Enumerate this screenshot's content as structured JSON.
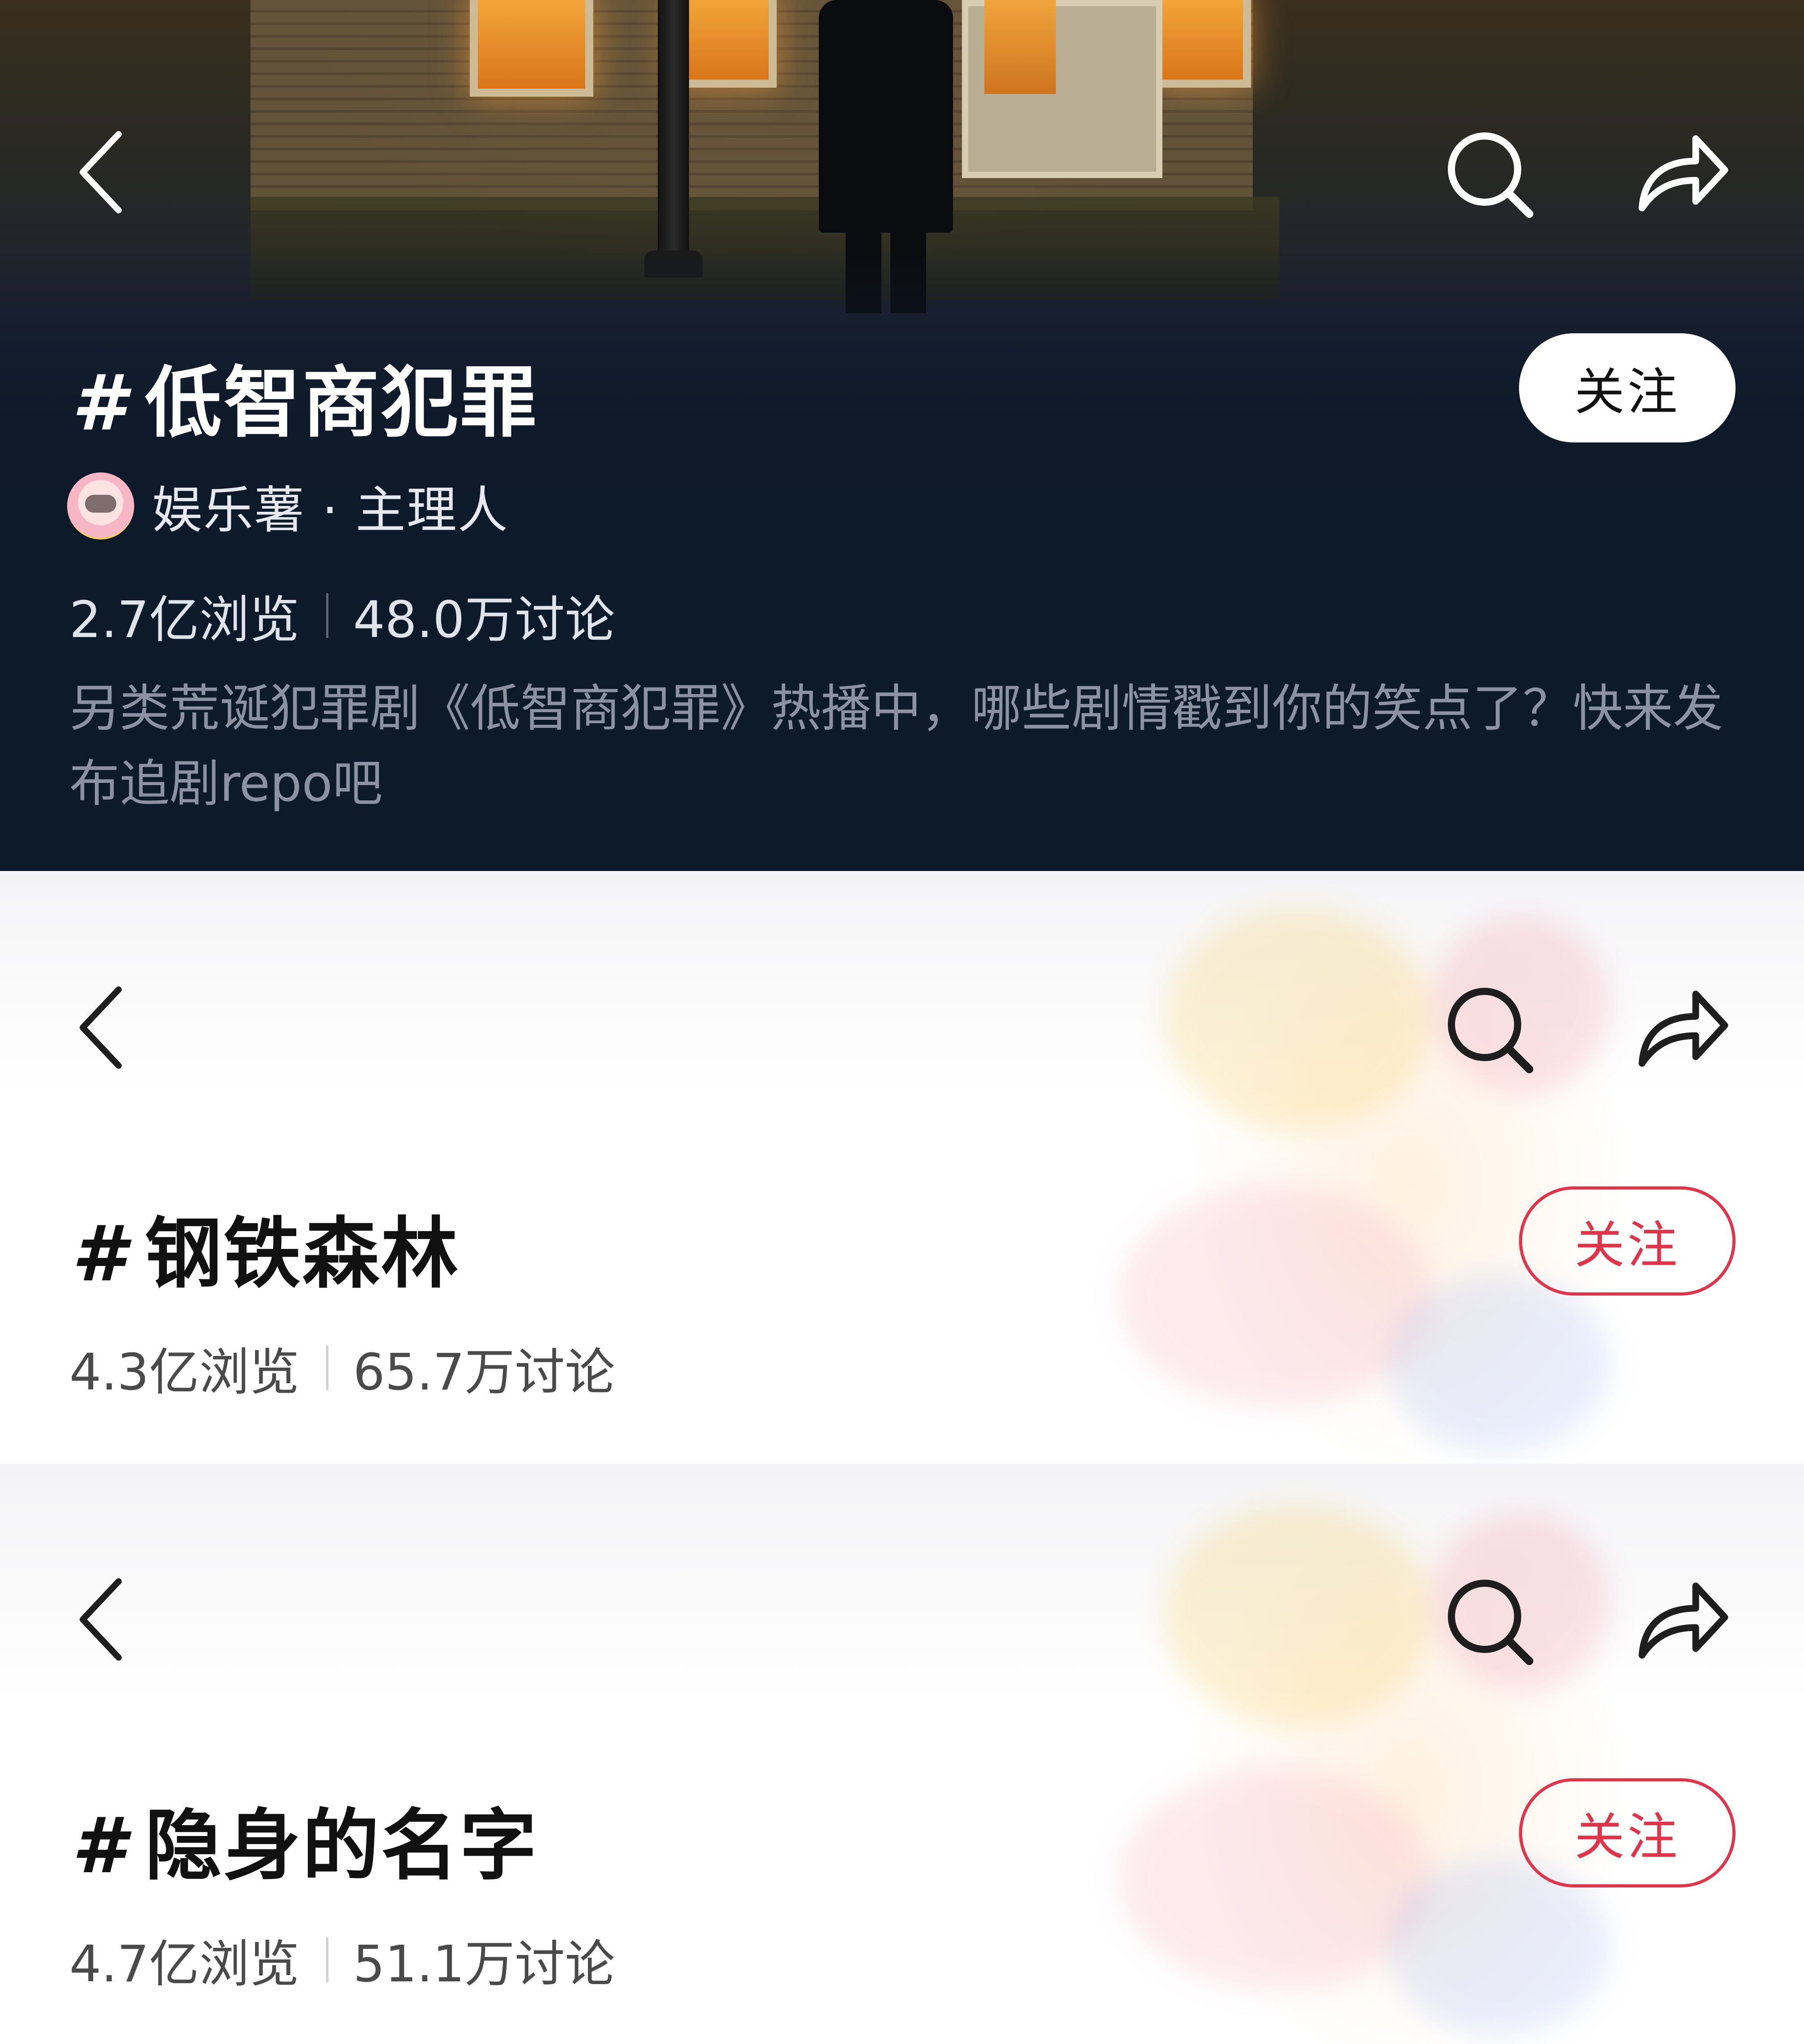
{
  "colors": {
    "accent": "#e0344a",
    "dark_bg": "#0d1a2a",
    "light_text": "#111111",
    "muted_text": "#8b93a2"
  },
  "icons": {
    "back": "back-chevron-icon",
    "search": "search-icon",
    "share": "share-arrow-icon"
  },
  "topics": [
    {
      "hash": "#",
      "title": "低智商犯罪",
      "follow_label": "关注",
      "host_name": "娱乐薯 · 主理人",
      "views": "2.7亿浏览",
      "discussions": "48.0万讨论",
      "description": "另类荒诞犯罪剧《低智商犯罪》热播中，哪些剧情戳到你的笑点了？快来发布追剧repo吧"
    },
    {
      "hash": "#",
      "title": "钢铁森林",
      "follow_label": "关注",
      "views": "4.3亿浏览",
      "discussions": "65.7万讨论"
    },
    {
      "hash": "#",
      "title": "隐身的名字",
      "follow_label": "关注",
      "views": "4.7亿浏览",
      "discussions": "51.1万讨论"
    }
  ]
}
